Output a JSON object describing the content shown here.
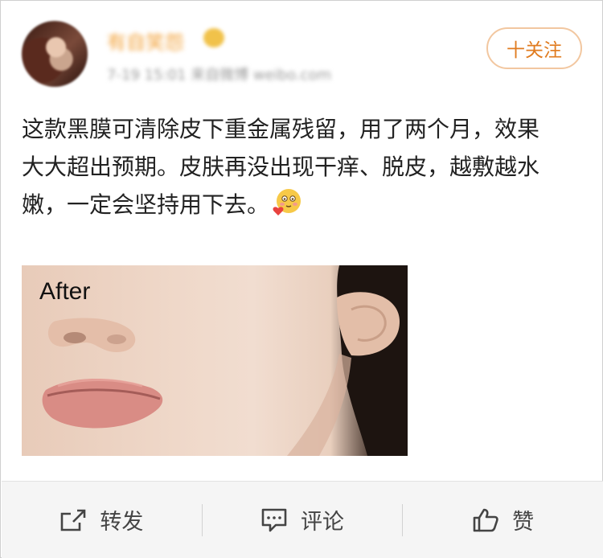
{
  "user": {
    "name": "有自笑怨",
    "meta": "7-19 15:01  来自微博 weibo.com"
  },
  "follow_button": {
    "label": "十关注"
  },
  "post": {
    "lines": [
      "这款黑膜可清除皮下重金属残留，用了两个月，效果",
      "大大超出预期。皮肤再没出现干痒、脱皮，越敷越水",
      "嫩，一定会坚持用下去。"
    ],
    "emoji_icon": "blush-heart-emoji-icon"
  },
  "photo": {
    "label": "After"
  },
  "actions": {
    "repost": {
      "label": "转发",
      "icon": "share-icon"
    },
    "comment": {
      "label": "评论",
      "icon": "comment-icon"
    },
    "like": {
      "label": "赞",
      "icon": "thumbs-up-icon"
    }
  },
  "colors": {
    "accent": "#e07b1f",
    "follow_border": "#f2c7a0",
    "username": "#f2a23a",
    "action_bar_bg": "#f5f5f5"
  }
}
